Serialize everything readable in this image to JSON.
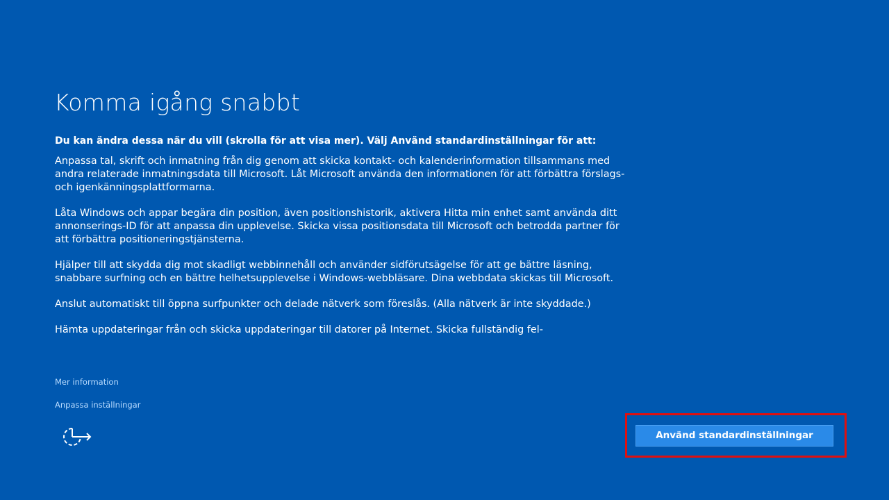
{
  "page": {
    "title": "Komma igång snabbt",
    "intro": "Du kan ändra dessa när du vill (skrolla för att visa mer). Välj Använd standardinställningar för att:",
    "paragraphs": [
      "Anpassa tal, skrift och inmatning från dig genom att skicka kontakt- och kalenderinformation tillsammans med andra relaterade inmatningsdata till Microsoft. Låt Microsoft använda den informationen för att förbättra förslags- och igenkänningsplattformarna.",
      "Låta Windows och appar begära din position, även positionshistorik, aktivera Hitta min enhet samt använda ditt annonserings-ID för att anpassa din upplevelse. Skicka vissa positionsdata till Microsoft och betrodda partner för att förbättra positioneringstjänsterna.",
      "Hjälper till att skydda dig mot skadligt webbinnehåll och använder sidförutsägelse för att ge bättre läsning, snabbare surfning och en bättre helhetsupplevelse i Windows-webbläsare. Dina webbdata skickas till Microsoft.",
      "Anslut automatiskt till öppna surfpunkter och delade nätverk som föreslås. (Alla nätverk är inte skyddade.)",
      "Hämta uppdateringar från och skicka uppdateringar till datorer på Internet. Skicka fullständig fel-"
    ]
  },
  "links": {
    "more_info": "Mer information",
    "customize": "Anpassa inställningar"
  },
  "buttons": {
    "use_defaults": "Använd standardinställningar"
  },
  "icons": {
    "accessibility": "ease-of-access-icon"
  },
  "colors": {
    "background": "#0058b0",
    "button": "#2a8ae8",
    "link": "#b9dcff",
    "highlight": "#e01010"
  }
}
